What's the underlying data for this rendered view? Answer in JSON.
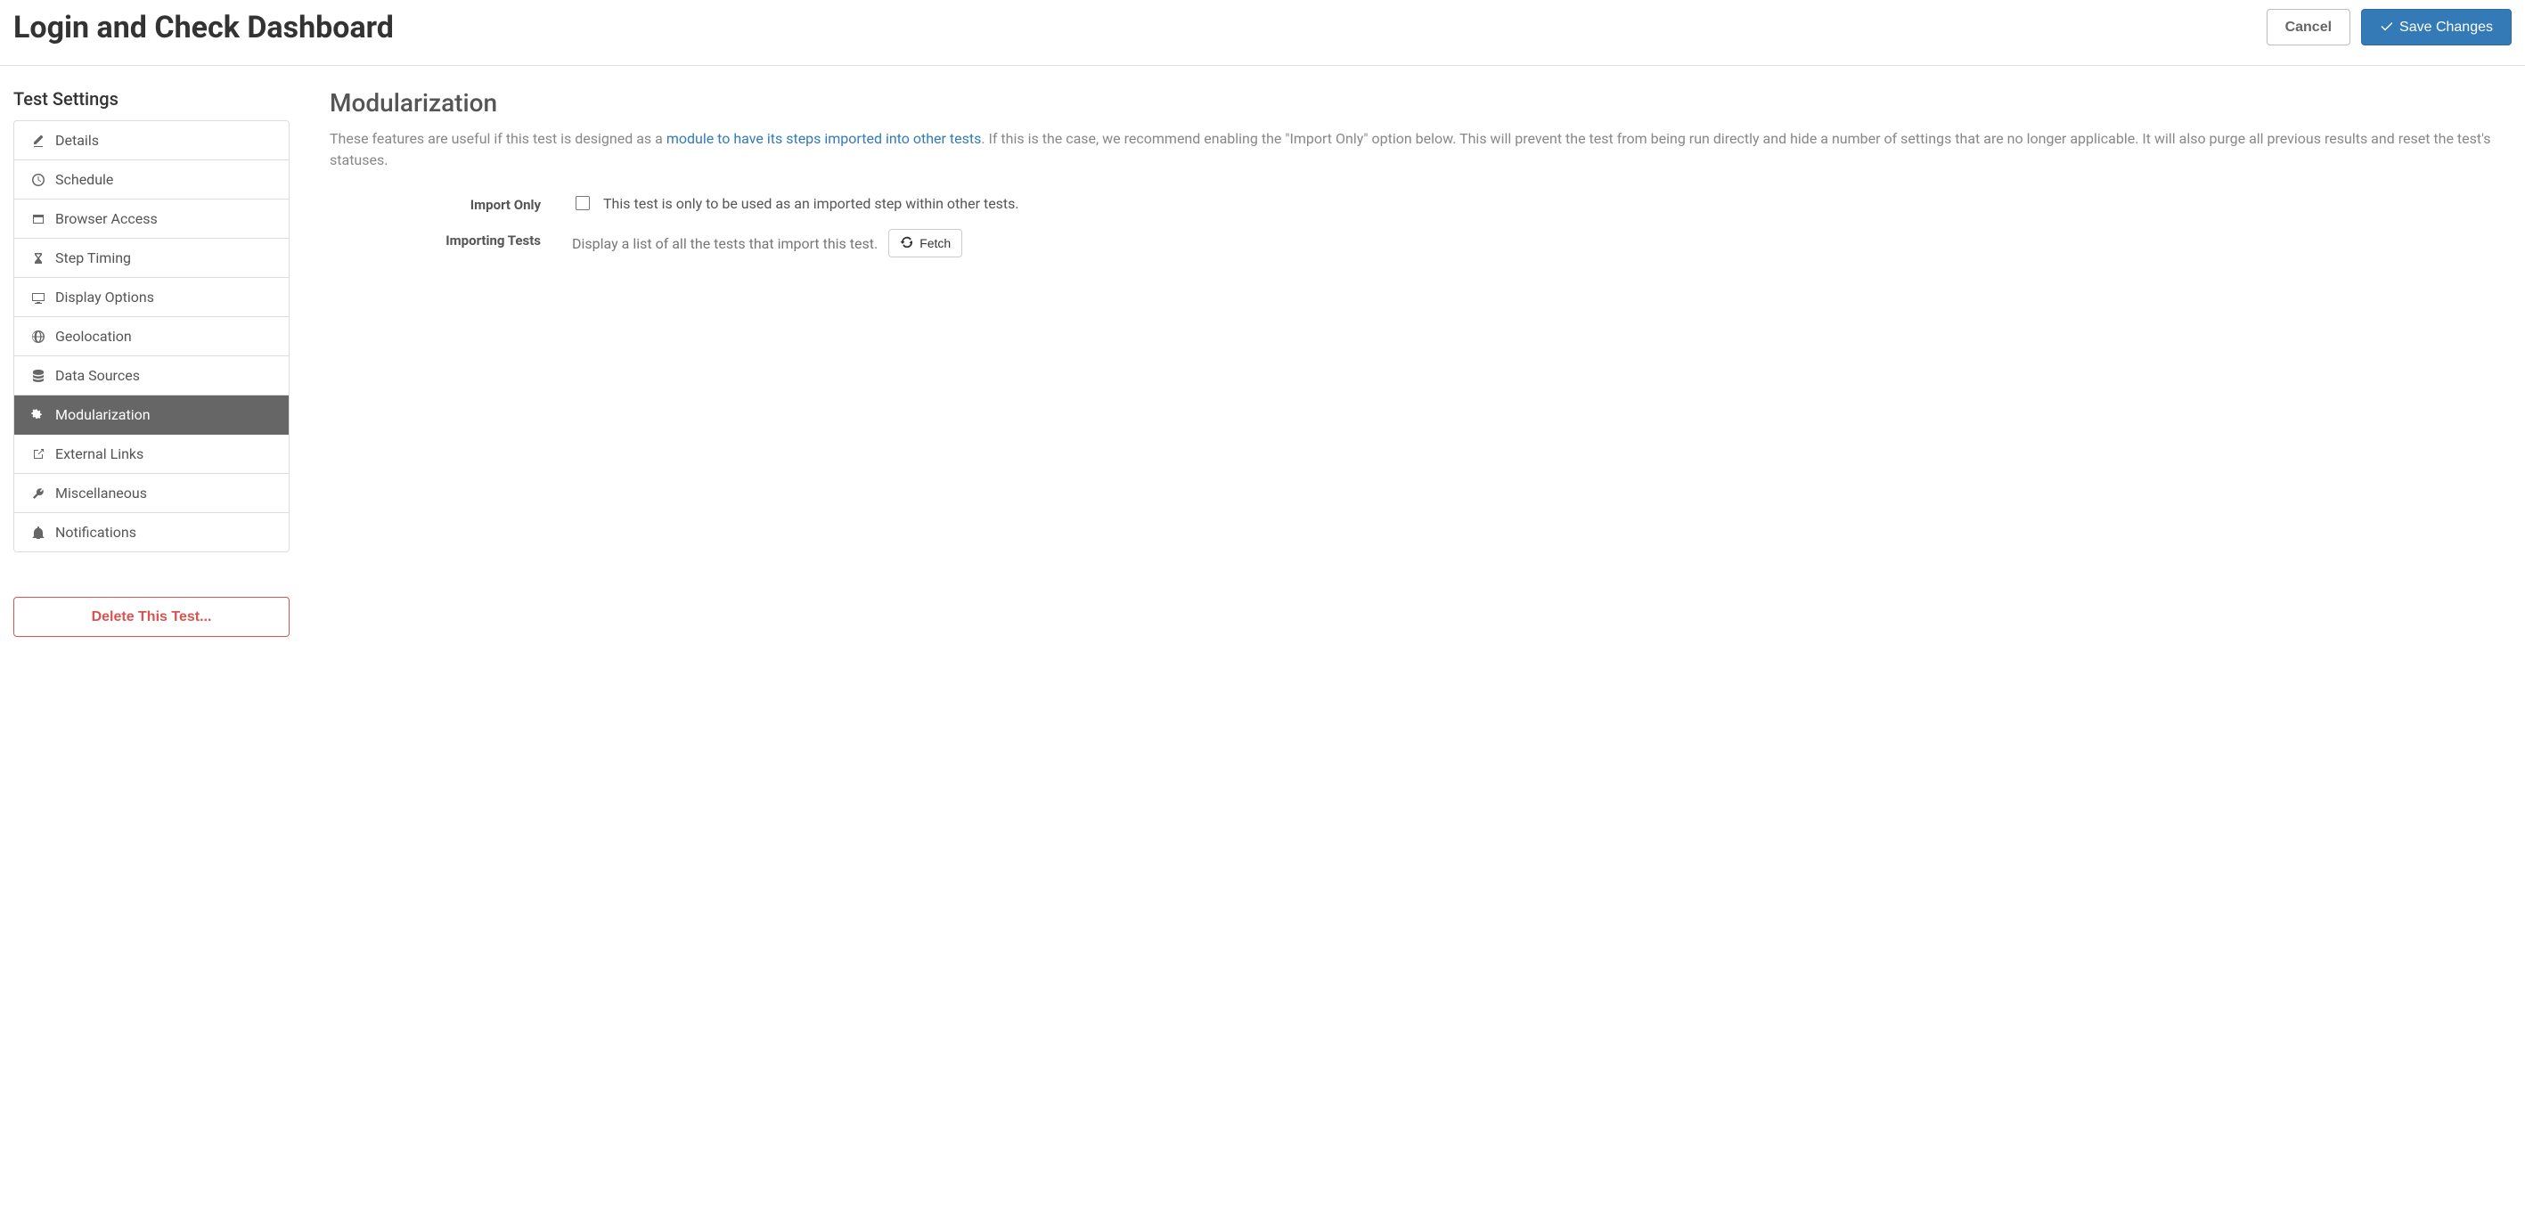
{
  "header": {
    "title": "Login and Check Dashboard",
    "cancel": "Cancel",
    "save": "Save Changes"
  },
  "sidebar": {
    "title": "Test Settings",
    "items": [
      {
        "icon": "pencil",
        "label": "Details"
      },
      {
        "icon": "clock",
        "label": "Schedule"
      },
      {
        "icon": "window",
        "label": "Browser Access"
      },
      {
        "icon": "hourglass",
        "label": "Step Timing"
      },
      {
        "icon": "monitor",
        "label": "Display Options"
      },
      {
        "icon": "globe",
        "label": "Geolocation"
      },
      {
        "icon": "database",
        "label": "Data Sources"
      },
      {
        "icon": "cogs",
        "label": "Modularization"
      },
      {
        "icon": "external",
        "label": "External Links"
      },
      {
        "icon": "wrench",
        "label": "Miscellaneous"
      },
      {
        "icon": "bell",
        "label": "Notifications"
      }
    ],
    "active_index": 7,
    "delete": "Delete This Test..."
  },
  "content": {
    "heading": "Modularization",
    "desc_pre": "These features are useful if this test is designed as a ",
    "desc_link": "module to have its steps imported into other tests",
    "desc_post": ". If this is the case, we recommend enabling the \"Import Only\" option below. This will prevent the test from being run directly and hide a number of settings that are no longer applicable. It will also purge all previous results and reset the test's statuses.",
    "import_only": {
      "label": "Import Only",
      "text": "This test is only to be used as an imported step within other tests."
    },
    "importing_tests": {
      "label": "Importing Tests",
      "text": "Display a list of all the tests that import this test.",
      "button": "Fetch"
    }
  }
}
